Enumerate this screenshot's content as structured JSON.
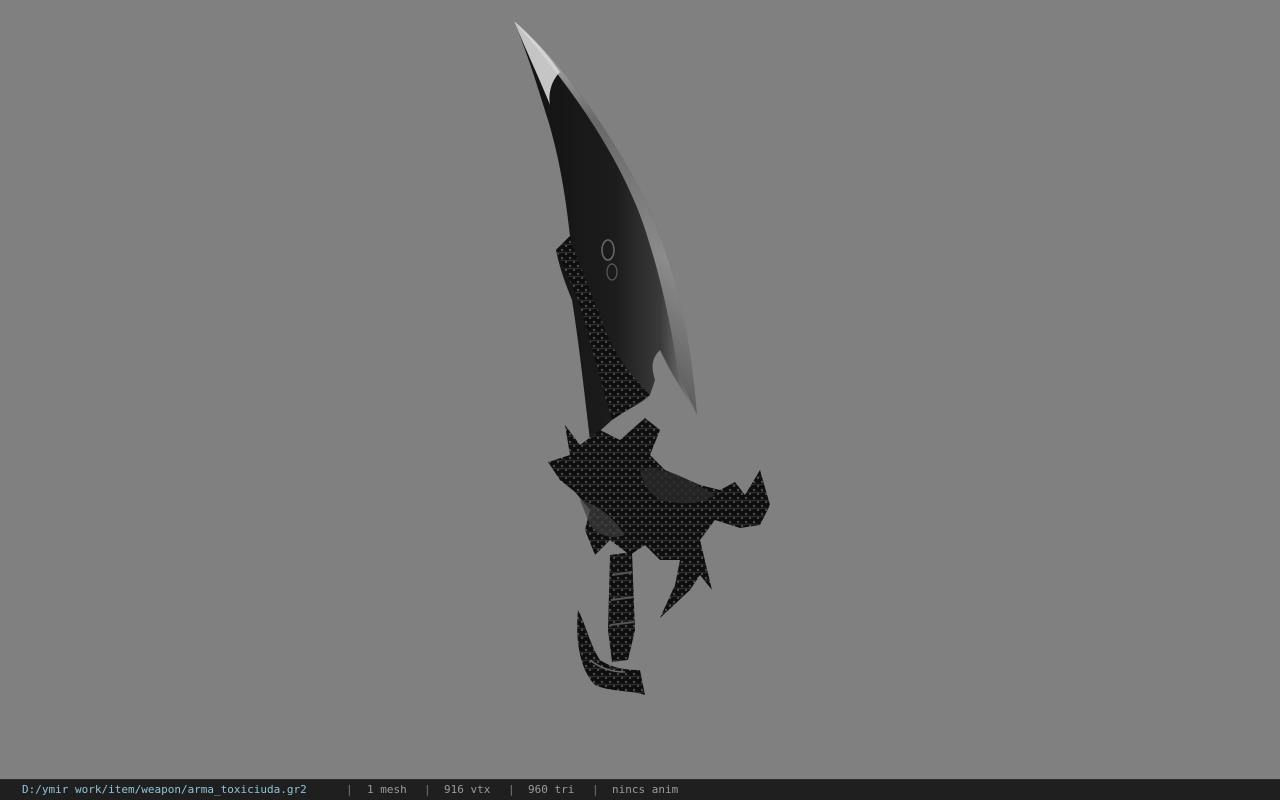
{
  "viewport": {
    "background_color": "#808080",
    "model_icon": "curved-sword-model"
  },
  "status_bar": {
    "file_path": "D:/ymir work/item/weapon/arma_toxiciuda.gr2",
    "separator": "|",
    "mesh_count": "1 mesh",
    "vertex_count": "916 vtx",
    "triangle_count": "960 tri",
    "anim_status": "nincs anim",
    "path_color": "#8ec3d6",
    "text_color": "#9a9a9a"
  }
}
